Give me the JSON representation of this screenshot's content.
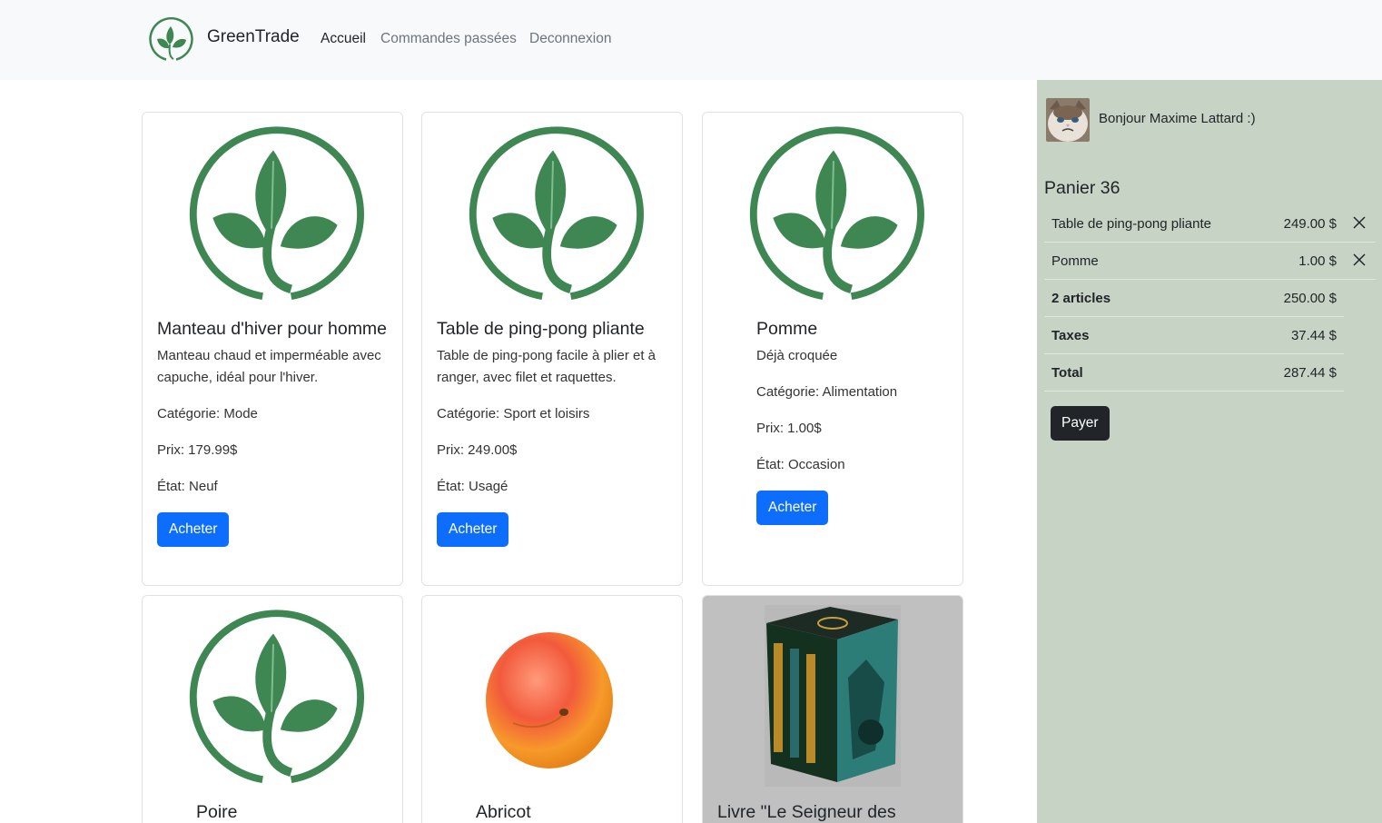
{
  "app": {
    "brand": "GreenTrade",
    "brand_color": "#3e8752"
  },
  "nav": {
    "links": [
      {
        "label": "Accueil",
        "active": true
      },
      {
        "label": "Commandes passées",
        "active": false
      },
      {
        "label": "Deconnexion",
        "active": false
      }
    ]
  },
  "products": [
    {
      "title": "Manteau d'hiver pour homme",
      "description": "Manteau chaud et imperméable avec capuche, idéal pour l'hiver.",
      "category": "Catégorie: Mode",
      "price": "Prix: 179.99$",
      "state": "État: Neuf",
      "button": "Acheter",
      "image": "greentrade-logo"
    },
    {
      "title": "Table de ping-pong pliante",
      "description": "Table de ping-pong facile à plier et à ranger, avec filet et raquettes.",
      "category": "Catégorie: Sport et loisirs",
      "price": "Prix: 249.00$",
      "state": "État: Usagé",
      "button": "Acheter",
      "image": "greentrade-logo"
    },
    {
      "title": "Pomme",
      "description": "Déjà croquée",
      "category": "Catégorie: Alimentation",
      "price": "Prix: 1.00$",
      "state": "État: Occasion",
      "button": "Acheter",
      "image": "greentrade-logo"
    },
    {
      "title": "Poire",
      "image": "greentrade-logo"
    },
    {
      "title": "Abricot",
      "image": "apricot-photo"
    },
    {
      "title": "Livre \"Le Seigneur des",
      "image": "book-box-photo"
    }
  ],
  "sidebar": {
    "greeting": "Bonjour Maxime Lattard :)",
    "avatar": "cat-avatar",
    "cart_title": "Panier 36",
    "items": [
      {
        "name": "Table de ping-pong pliante",
        "price": "249.00 $"
      },
      {
        "name": "Pomme",
        "price": "1.00 $"
      }
    ],
    "summary": [
      {
        "label": "2 articles",
        "value": "250.00 $"
      },
      {
        "label": "Taxes",
        "value": "37.44 $"
      },
      {
        "label": "Total",
        "value": "287.44 $"
      }
    ],
    "pay_button": "Payer",
    "background": "#c7d3c5"
  }
}
